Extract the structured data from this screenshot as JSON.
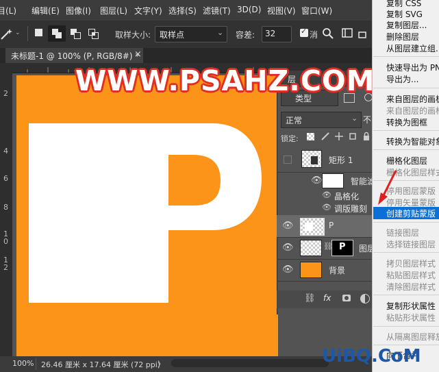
{
  "menubar": {
    "items": [
      "目(L)",
      "编辑(E)",
      "图像(I)",
      "图层(L)",
      "文字(Y)",
      "选择(S)",
      "滤镜(T)",
      "3D(D)",
      "视图(V)",
      "窗口(W)"
    ]
  },
  "options_bar": {
    "sample_size_label": "取样大小:",
    "sample_size_value": "取样点",
    "tolerance_label": "容差:",
    "tolerance_value": "32",
    "extra_label": "消"
  },
  "document": {
    "tab_title": "未标题-1 @ 100% (P, RGB/8#) *",
    "close_glyph": "×",
    "canvas_color": "#fc9419",
    "canvas_letter": "P",
    "ruler_left_numbers": [
      "2",
      "4",
      "6",
      "8",
      "1\n0",
      "1\n2"
    ]
  },
  "status": {
    "zoom": "100%",
    "doc_info": "26.46 厘米 x 17.64 厘米 (72 ppi)",
    "arrow": "〉"
  },
  "watermark": {
    "text": "WWW.PSAHZ.COM",
    "stroke_color": "#e02e25"
  },
  "layers_panel": {
    "tab_label": "层",
    "filter_label": "类型",
    "blend_mode": "正常",
    "opacity_prefix": "不",
    "lock_label": "锁定:",
    "layers": [
      {
        "name": "矩形 1",
        "visible": false
      },
      {
        "name": "智能滤",
        "visible": true
      },
      {
        "name": "晶格化",
        "visible": true
      },
      {
        "name": "调版雕刻",
        "visible": true
      },
      {
        "name": "P",
        "visible": true,
        "selected": true
      },
      {
        "name": "图层",
        "visible": true
      },
      {
        "name": "背景",
        "visible": true
      }
    ],
    "footer_icons": [
      "link-icon",
      "fx-icon",
      "mask-icon",
      "adjustment-icon"
    ],
    "fx_label": "fx"
  },
  "context_menu": {
    "items": [
      {
        "label": "复制 CSS",
        "enabled": true
      },
      {
        "label": "复制 SVG",
        "enabled": true
      },
      {
        "label": "复制图层...",
        "enabled": true
      },
      {
        "label": "删除图层",
        "enabled": true
      },
      {
        "label": "从图层建立组...",
        "enabled": true
      },
      {
        "label": "快速导出为 PN",
        "enabled": true
      },
      {
        "label": "导出为...",
        "enabled": true
      },
      {
        "label": "来自图层的画板",
        "enabled": true
      },
      {
        "label": "来自图层的画框",
        "enabled": false
      },
      {
        "label": "转换为图框",
        "enabled": true
      },
      {
        "label": "转换为智能对象",
        "enabled": true
      },
      {
        "label": "栅格化图层",
        "enabled": true
      },
      {
        "label": "栅格化图层样式",
        "enabled": false
      },
      {
        "label": "停用图层蒙版",
        "enabled": false
      },
      {
        "label": "停用矢量蒙版",
        "enabled": false
      },
      {
        "label": "创建剪贴蒙版",
        "enabled": true,
        "highlighted": true
      },
      {
        "label": "链接图层",
        "enabled": false
      },
      {
        "label": "选择链接图层",
        "enabled": false
      },
      {
        "label": "拷贝图层样式",
        "enabled": false
      },
      {
        "label": "粘贴图层样式",
        "enabled": false
      },
      {
        "label": "清除图层样式",
        "enabled": false
      },
      {
        "label": "复制形状属性",
        "enabled": true
      },
      {
        "label": "粘贴形状属性",
        "enabled": false
      },
      {
        "label": "从隔离图层释放",
        "enabled": false
      },
      {
        "label": "向下合并",
        "enabled": true
      }
    ],
    "highlight_color": "#0a6fd6"
  },
  "site_watermark": {
    "text": "UiBQ.CoM"
  }
}
